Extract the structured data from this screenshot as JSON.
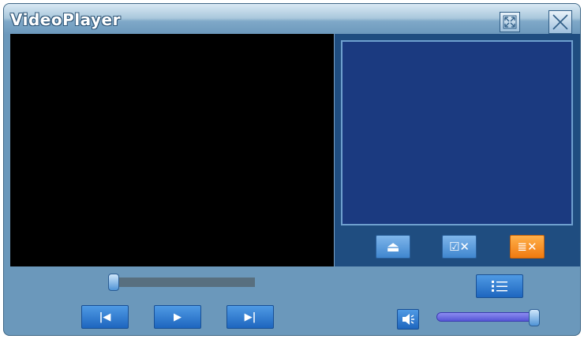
{
  "window": {
    "title": "VideoPlayer"
  },
  "titlebar": {
    "maximize_icon": "maximize-icon",
    "close_icon": "close-icon"
  },
  "playlist": {
    "buttons": {
      "eject": {
        "label": "⏏",
        "icon": "eject-icon"
      },
      "remove_checked": {
        "label": "☑✕",
        "icon": "remove-checked-icon"
      },
      "clear_list": {
        "label": "≣✕",
        "icon": "clear-list-icon"
      }
    }
  },
  "controls": {
    "prev_label": "|◀",
    "play_label": "▶",
    "next_label": "▶|",
    "seek_position": 0.0,
    "volume_level": 0.95,
    "playlist_toggle_icon": "playlist-icon",
    "mute_icon": "speaker-icon"
  },
  "colors": {
    "accent_blue": "#2a74c8",
    "orange": "#f07a10",
    "panel_bg": "#1f4d80",
    "video_bg": "#000000"
  }
}
